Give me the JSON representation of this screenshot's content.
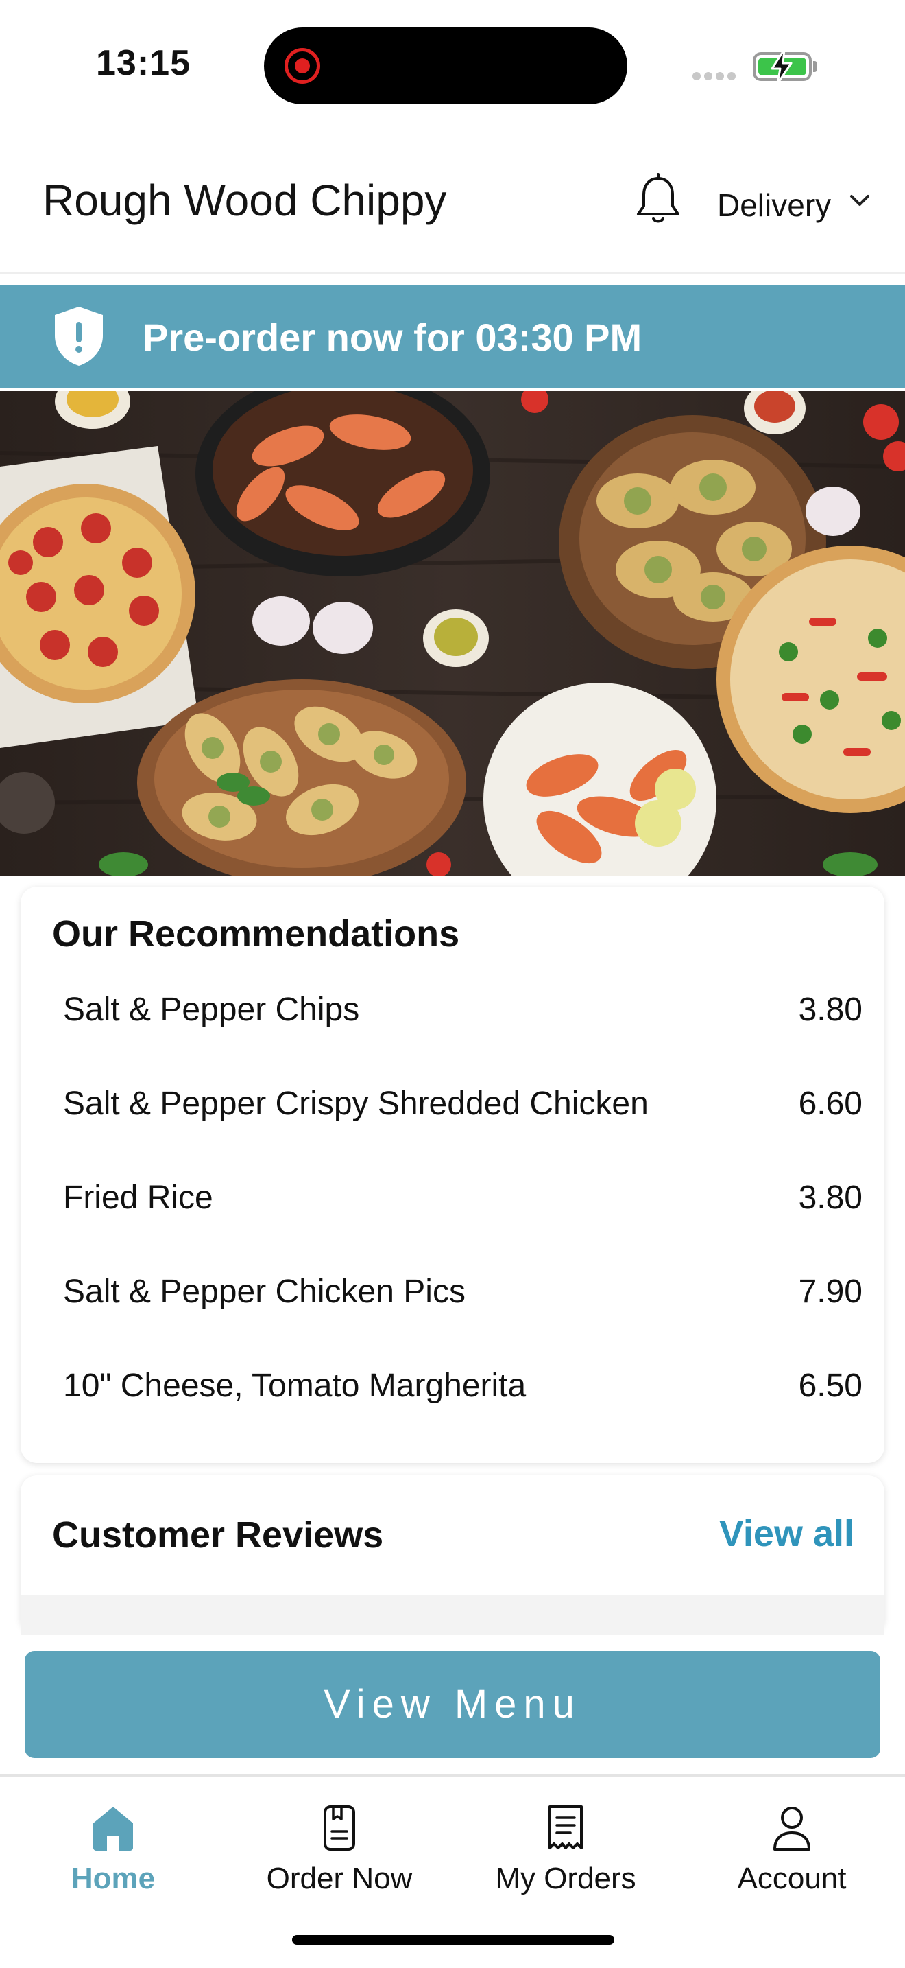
{
  "status_bar": {
    "time": "13:15"
  },
  "header": {
    "restaurant_name": "Rough Wood Chippy",
    "order_mode": "Delivery"
  },
  "banner": {
    "text": "Pre-order now for 03:30 PM"
  },
  "recommendations": {
    "title": "Our Recommendations",
    "items": [
      {
        "name": "Salt & Pepper Chips",
        "price": "3.80"
      },
      {
        "name": "Salt & Pepper Crispy Shredded Chicken",
        "price": "6.60"
      },
      {
        "name": "Fried Rice",
        "price": "3.80"
      },
      {
        "name": "Salt & Pepper Chicken Pics",
        "price": "7.90"
      },
      {
        "name": "10\" Cheese, Tomato Margherita",
        "price": "6.50"
      }
    ]
  },
  "reviews": {
    "title": "Customer Reviews",
    "view_all": "View all"
  },
  "cta": {
    "label": "View Menu"
  },
  "bottom_nav": {
    "items": [
      {
        "label": "Home",
        "icon": "home-icon",
        "active": true
      },
      {
        "label": "Order Now",
        "icon": "order-icon",
        "active": false
      },
      {
        "label": "My Orders",
        "icon": "receipt-icon",
        "active": false
      },
      {
        "label": "Account",
        "icon": "account-icon",
        "active": false
      }
    ]
  },
  "colors": {
    "accent": "#5ca3ba",
    "link": "#2f94bb"
  }
}
